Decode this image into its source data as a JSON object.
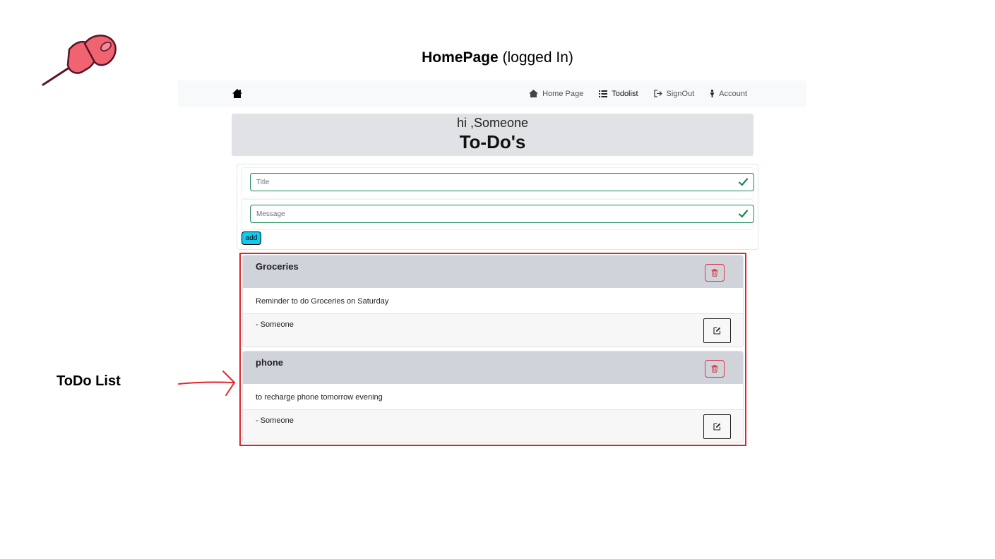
{
  "slide": {
    "title_bold": "HomePage",
    "title_rest": " (logged In)",
    "side_label": "ToDo List"
  },
  "navbar": {
    "brand_icon": "home-icon",
    "links": [
      {
        "label": "Home Page",
        "icon": "home-icon"
      },
      {
        "label": "Todolist",
        "icon": "list-icon",
        "active": true
      },
      {
        "label": "SignOut",
        "icon": "sign-out-icon"
      },
      {
        "label": "Account",
        "icon": "person-icon"
      }
    ]
  },
  "hero": {
    "greeting": "hi ,Someone",
    "title": "To-Do's"
  },
  "form": {
    "title_placeholder": "Title",
    "message_placeholder": "Message",
    "add_label": "add"
  },
  "todos": [
    {
      "title": "Groceries",
      "message": "Reminder to do Groceries on Saturday",
      "author": "- Someone"
    },
    {
      "title": "phone",
      "message": "to recharge phone tomorrow evening",
      "author": "- Someone"
    }
  ],
  "colors": {
    "valid_border": "#198754",
    "add_button": "#0dcaf0",
    "delete_outline": "#dc3545",
    "highlight_frame": "#e0242b",
    "pin": "#f06370"
  }
}
